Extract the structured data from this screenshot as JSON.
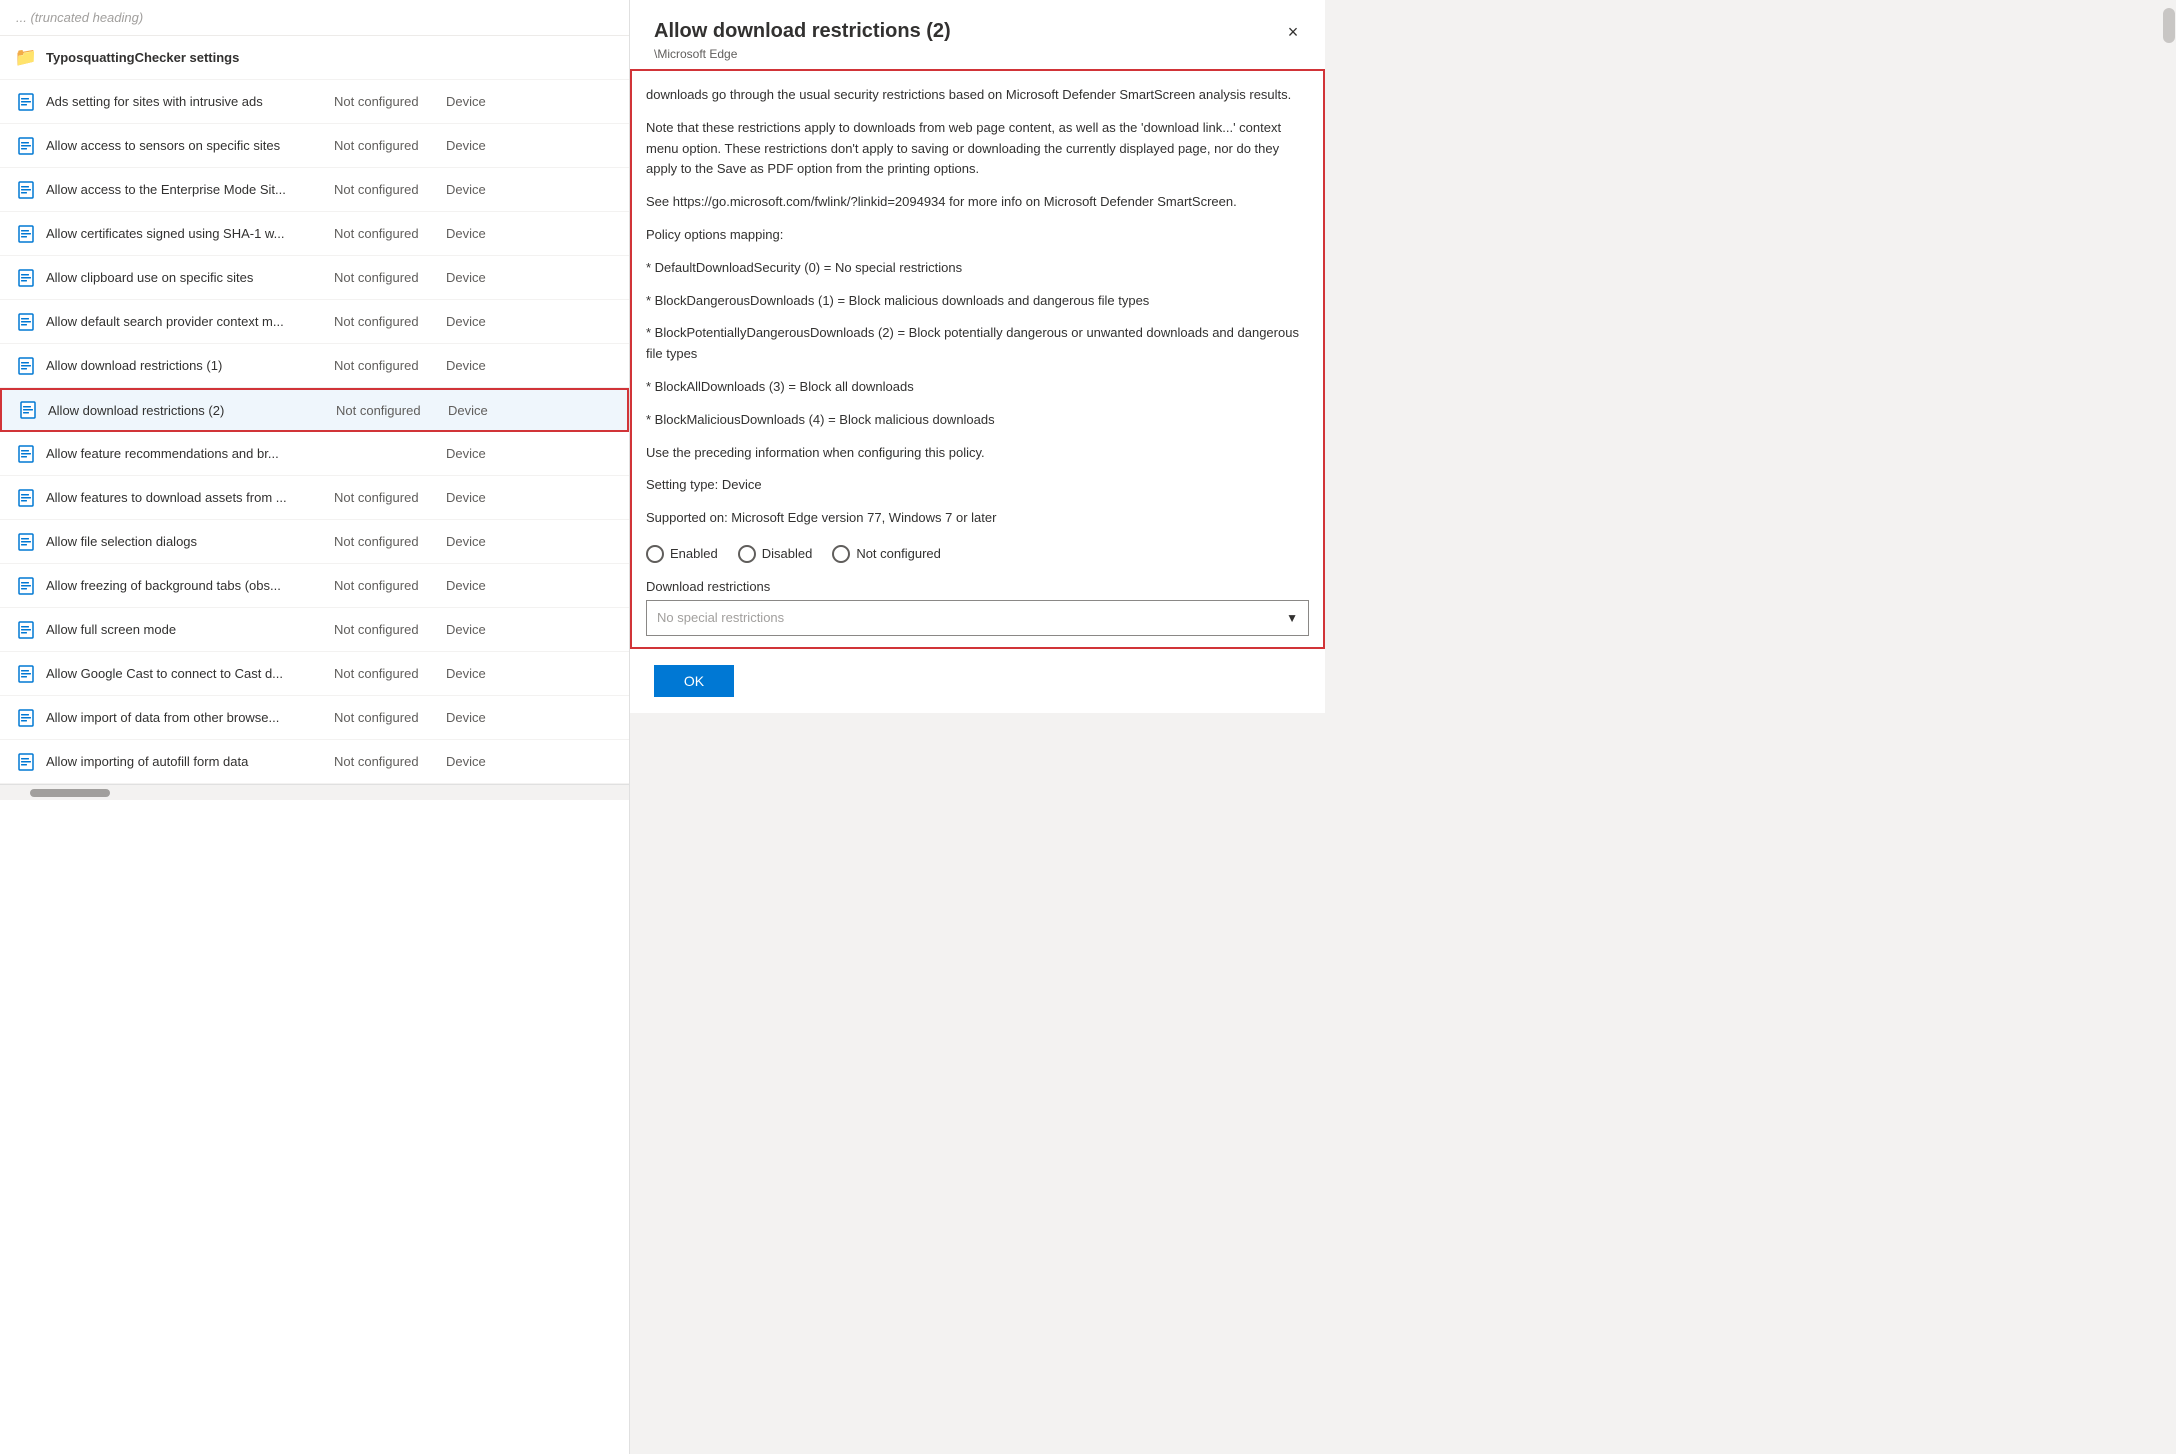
{
  "leftPanel": {
    "items": [
      {
        "type": "truncated-header",
        "label": "... (truncated heading)"
      },
      {
        "type": "folder",
        "icon": "folder",
        "name": "TyposquattingChecker settings",
        "status": "",
        "scope": ""
      },
      {
        "type": "doc",
        "icon": "doc",
        "name": "Ads setting for sites with intrusive ads",
        "status": "Not configured",
        "scope": "Device"
      },
      {
        "type": "doc",
        "icon": "doc",
        "name": "Allow access to sensors on specific sites",
        "status": "Not configured",
        "scope": "Device"
      },
      {
        "type": "doc",
        "icon": "doc",
        "name": "Allow access to the Enterprise Mode Sit...",
        "status": "Not configured",
        "scope": "Device"
      },
      {
        "type": "doc",
        "icon": "doc",
        "name": "Allow certificates signed using SHA-1 w...",
        "status": "Not configured",
        "scope": "Device"
      },
      {
        "type": "doc",
        "icon": "doc",
        "name": "Allow clipboard use on specific sites",
        "status": "Not configured",
        "scope": "Device"
      },
      {
        "type": "doc",
        "icon": "doc",
        "name": "Allow default search provider context m...",
        "status": "Not configured",
        "scope": "Device"
      },
      {
        "type": "doc",
        "icon": "doc",
        "name": "Allow download restrictions (1)",
        "status": "Not configured",
        "scope": "Device"
      },
      {
        "type": "doc",
        "icon": "doc",
        "name": "Allow download restrictions (2)",
        "status": "Not configured",
        "scope": "Device",
        "selected": true
      },
      {
        "type": "doc",
        "icon": "doc",
        "name": "Allow feature recommendations and br...",
        "status": "",
        "scope": "Device"
      },
      {
        "type": "doc",
        "icon": "doc",
        "name": "Allow features to download assets from ...",
        "status": "Not configured",
        "scope": "Device"
      },
      {
        "type": "doc",
        "icon": "doc",
        "name": "Allow file selection dialogs",
        "status": "Not configured",
        "scope": "Device"
      },
      {
        "type": "doc",
        "icon": "doc",
        "name": "Allow freezing of background tabs (obs...",
        "status": "Not configured",
        "scope": "Device"
      },
      {
        "type": "doc",
        "icon": "doc",
        "name": "Allow full screen mode",
        "status": "Not configured",
        "scope": "Device"
      },
      {
        "type": "doc",
        "icon": "doc",
        "name": "Allow Google Cast to connect to Cast d...",
        "status": "Not configured",
        "scope": "Device"
      },
      {
        "type": "doc",
        "icon": "doc",
        "name": "Allow import of data from other browse...",
        "status": "Not configured",
        "scope": "Device"
      },
      {
        "type": "doc",
        "icon": "doc",
        "name": "Allow importing of autofill form data",
        "status": "Not configured",
        "scope": "Device"
      }
    ]
  },
  "dialog": {
    "title": "Allow download restrictions (2)",
    "subtitle": "\\Microsoft Edge",
    "close_label": "×",
    "description_paragraphs": [
      "downloads go through the usual security restrictions based on Microsoft Defender SmartScreen analysis results.",
      "Note that these restrictions apply to downloads from web page content, as well as the 'download link...' context menu option. These restrictions don't apply to saving or downloading the currently displayed page, nor do they apply to the Save as PDF option from the printing options.",
      "See https://go.microsoft.com/fwlink/?linkid=2094934 for more info on Microsoft Defender SmartScreen.",
      "Policy options mapping:",
      "* DefaultDownloadSecurity (0) = No special restrictions",
      "* BlockDangerousDownloads (1) = Block malicious downloads and dangerous file types",
      "* BlockPotentiallyDangerousDownloads (2) = Block potentially dangerous or unwanted downloads and dangerous file types",
      "* BlockAllDownloads (3) = Block all downloads",
      "* BlockMaliciousDownloads (4) = Block malicious downloads",
      "Use the preceding information when configuring this policy.",
      "Setting type: Device",
      "Supported on: Microsoft Edge version 77, Windows 7 or later"
    ],
    "radio_options": [
      {
        "label": "Enabled",
        "selected": false
      },
      {
        "label": "Disabled",
        "selected": false
      },
      {
        "label": "Not configured",
        "selected": false
      }
    ],
    "dropdown": {
      "label": "Download restrictions",
      "placeholder": "No special restrictions"
    },
    "footer": {
      "ok_label": "OK"
    }
  }
}
